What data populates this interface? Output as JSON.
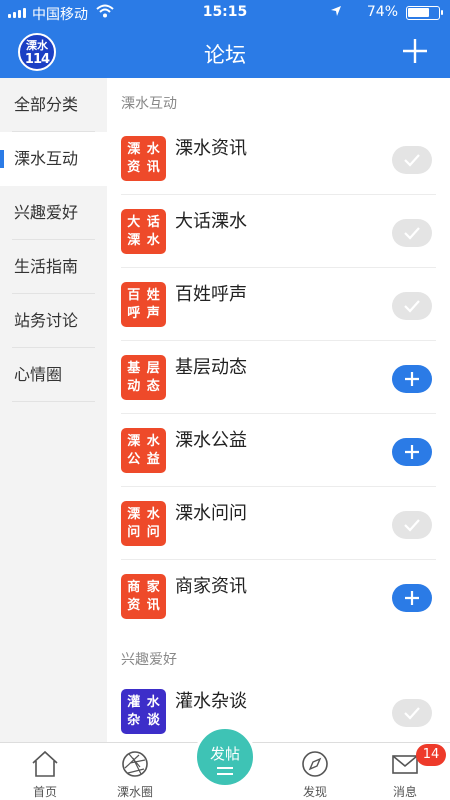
{
  "status_bar": {
    "carrier": "中国移动",
    "time": "15:15",
    "battery_percent": "74%",
    "battery_level": 0.74
  },
  "header": {
    "logo_line1": "溧水",
    "logo_line2": "114",
    "title": "论坛",
    "add_icon": "plus-icon"
  },
  "sidebar": {
    "items": [
      {
        "label": "全部分类",
        "active": false
      },
      {
        "label": "溧水互动",
        "active": true
      },
      {
        "label": "兴趣爱好",
        "active": false
      },
      {
        "label": "生活指南",
        "active": false
      },
      {
        "label": "站务讨论",
        "active": false
      },
      {
        "label": "心情圈",
        "active": false
      }
    ]
  },
  "sections": [
    {
      "title": "溧水互动"
    },
    {
      "title": "兴趣爱好"
    }
  ],
  "forums": [
    {
      "name": "溧水资讯",
      "badge": [
        "溧",
        "水",
        "资",
        "讯"
      ],
      "badge_color": "#ee4a2a",
      "subscribed": true
    },
    {
      "name": "大话溧水",
      "badge": [
        "大",
        "话",
        "溧",
        "水"
      ],
      "badge_color": "#ee4a2a",
      "subscribed": true
    },
    {
      "name": "百姓呼声",
      "badge": [
        "百",
        "姓",
        "呼",
        "声"
      ],
      "badge_color": "#ee4a2a",
      "subscribed": true
    },
    {
      "name": "基层动态",
      "badge": [
        "基",
        "层",
        "动",
        "态"
      ],
      "badge_color": "#ee4a2a",
      "subscribed": false
    },
    {
      "name": "溧水公益",
      "badge": [
        "溧",
        "水",
        "公",
        "益"
      ],
      "badge_color": "#ee4a2a",
      "subscribed": false
    },
    {
      "name": "溧水问问",
      "badge": [
        "溧",
        "水",
        "问",
        "问"
      ],
      "badge_color": "#ee4a2a",
      "subscribed": true
    },
    {
      "name": "商家资讯",
      "badge": [
        "商",
        "家",
        "资",
        "讯"
      ],
      "badge_color": "#ee4a2a",
      "subscribed": false
    },
    {
      "name": "灌水杂谈",
      "badge": [
        "灌",
        "水",
        "杂",
        "谈"
      ],
      "badge_color": "#3d2ec9",
      "subscribed": true
    }
  ],
  "tabbar": {
    "items": [
      {
        "label": "首页",
        "icon": "home-icon"
      },
      {
        "label": "溧水圈",
        "icon": "aperture-icon"
      },
      {
        "label": "发现",
        "icon": "compass-icon"
      },
      {
        "label": "消息",
        "icon": "mail-icon"
      }
    ],
    "post_label": "发帖",
    "message_count": "14"
  },
  "colors": {
    "accent": "#2b7be6",
    "badge_red": "#ee4a2a",
    "badge_purple": "#3d2ec9",
    "post_button": "#3ec3b5"
  }
}
